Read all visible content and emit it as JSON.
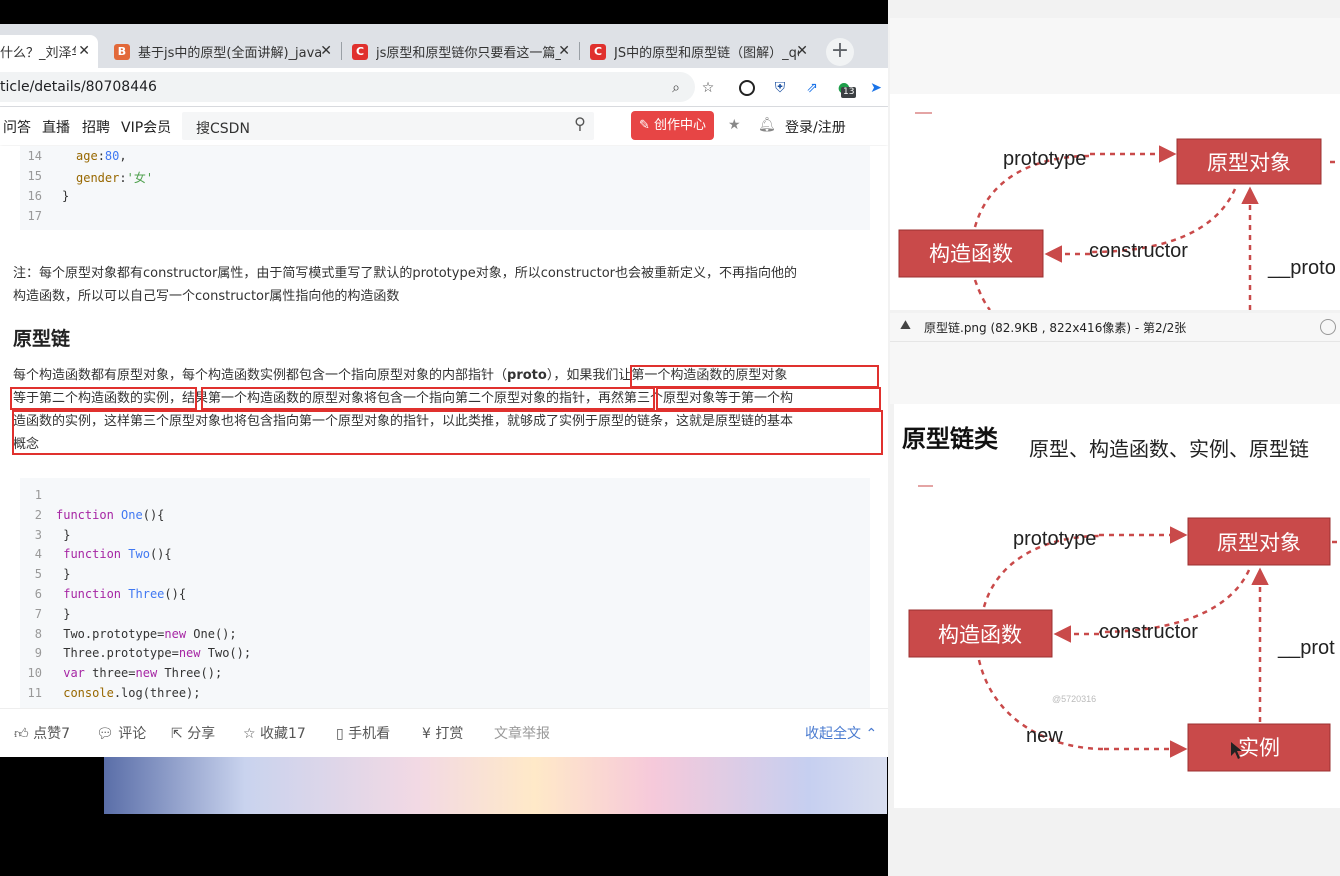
{
  "browser": {
    "tabs": [
      {
        "title": "什么？_刘泽华",
        "favicon": "C",
        "favcolor": "#e0312e",
        "active": true
      },
      {
        "title": "基于js中的原型(全面讲解)_javasc",
        "favicon": "B",
        "favcolor": "#e2693a",
        "active": false
      },
      {
        "title": "js原型和原型链你只要看这一篇_c",
        "favicon": "C",
        "favcolor": "#e0312e",
        "active": false
      },
      {
        "title": "JS中的原型和原型链（图解）_qq",
        "favicon": "C",
        "favcolor": "#e0312e",
        "active": false
      }
    ],
    "new_tab": "+",
    "close": "✕",
    "url": "ticle/details/80708446",
    "ext_badge": "13"
  },
  "csdn_nav": {
    "links": [
      "问答",
      "直播",
      "招聘",
      "VIP会员"
    ],
    "search_placeholder": "搜CSDN",
    "create_label": "创作中心",
    "login_label": "登录/注册"
  },
  "code_top": {
    "lines": [
      {
        "n": "14",
        "text": "age:80,"
      },
      {
        "n": "15",
        "text": "gender:'女'"
      },
      {
        "n": "16",
        "text": "}"
      },
      {
        "n": "17",
        "text": ""
      }
    ]
  },
  "article": {
    "note_line1": "注：每个原型对象都有constructor属性，由于简写模式重写了默认的prototype对象，所以constructor也会被重新定义，不再指向他的",
    "note_line2": "构造函数，所以可以自己写一个constructor属性指向他的构造函数",
    "heading": "原型链",
    "para_line1a": "每个构造函数都有原型对象，每个构造函数实例都包含一个指向原型对象的内部指针（",
    "para_bold": "proto",
    "para_line1b": "），如果我们让第一个构造函数的原型对象",
    "para_line2": "等于第二个构造函数的实例，结果第一个构造函数的原型对象将包含一个指向第二个原型对象的指针，再然第三个原型对象等于第一个构",
    "para_line3": "造函数的实例，这样第三个原型对象也将包含指向第一个原型对象的指针，以此类推，就够成了实例于原型的链条，这就是原型链的基本",
    "para_line4": "概念"
  },
  "code_main": {
    "lines": [
      {
        "n": "1",
        "text": ""
      },
      {
        "n": "2",
        "text": "function One(){"
      },
      {
        "n": "3",
        "text": " }"
      },
      {
        "n": "4",
        "text": " function Two(){"
      },
      {
        "n": "5",
        "text": " }"
      },
      {
        "n": "6",
        "text": " function Three(){"
      },
      {
        "n": "7",
        "text": " }"
      },
      {
        "n": "8",
        "text": " Two.prototype=new One();"
      },
      {
        "n": "9",
        "text": " Three.prototype=new Two();"
      },
      {
        "n": "10",
        "text": " var three=new Three();"
      },
      {
        "n": "11",
        "text": " console.log(three);"
      }
    ]
  },
  "bottom_bar": {
    "like": "点赞7",
    "comment": "评论",
    "share": "分享",
    "favorite": "收藏17",
    "mobile": "手机看",
    "reward": "打赏",
    "report": "文章举报",
    "collapse": "收起全文"
  },
  "viewer": {
    "title": "原型链.png (82.9KB , 822x416像素) - 第2/2张",
    "diagram_top": {
      "prototype": "prototype",
      "proto_obj": "原型对象",
      "constructor_fn": "构造函数",
      "constructor": "constructor",
      "proto_link": "__proto"
    },
    "diagram_main": {
      "title": "原型链类",
      "subtitle": "原型、构造函数、实例、原型链",
      "prototype": "prototype",
      "proto_obj": "原型对象",
      "constructor_fn": "构造函数",
      "constructor": "constructor",
      "proto_link": "__prot",
      "new": "new",
      "instance": "实例",
      "watermark": "@5720316"
    },
    "box_color": "#c94a4a"
  }
}
